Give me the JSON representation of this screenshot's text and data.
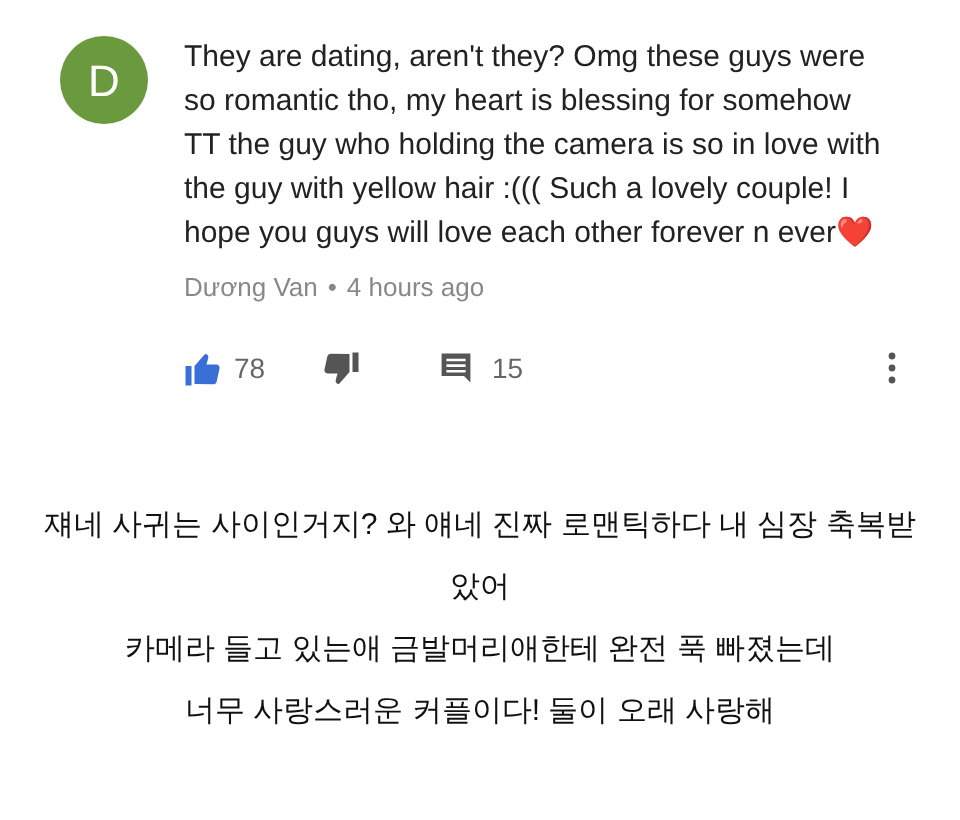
{
  "comment": {
    "avatar_letter": "D",
    "text": "They are dating, aren't they? Omg these guys were so romantic tho, my heart is blessing for somehow TT the guy who holding the camera is so in love with the guy with yellow hair :((( Such a lovely couple! I hope you guys will love each other forever n ever❤️",
    "author": "Dương Van",
    "separator": "•",
    "time": "4 hours ago",
    "likes": "78",
    "liked": true,
    "replies": "15"
  },
  "translation": [
    "쟤네 사귀는 사이인거지? 와 얘네 진짜 로맨틱하다 내 심장 축복받",
    "았어",
    "카메라 들고 있는애 금발머리애한테 완전 푹 빠졌는데",
    "너무 사랑스러운 커플이다! 둘이 오래 사랑해"
  ]
}
